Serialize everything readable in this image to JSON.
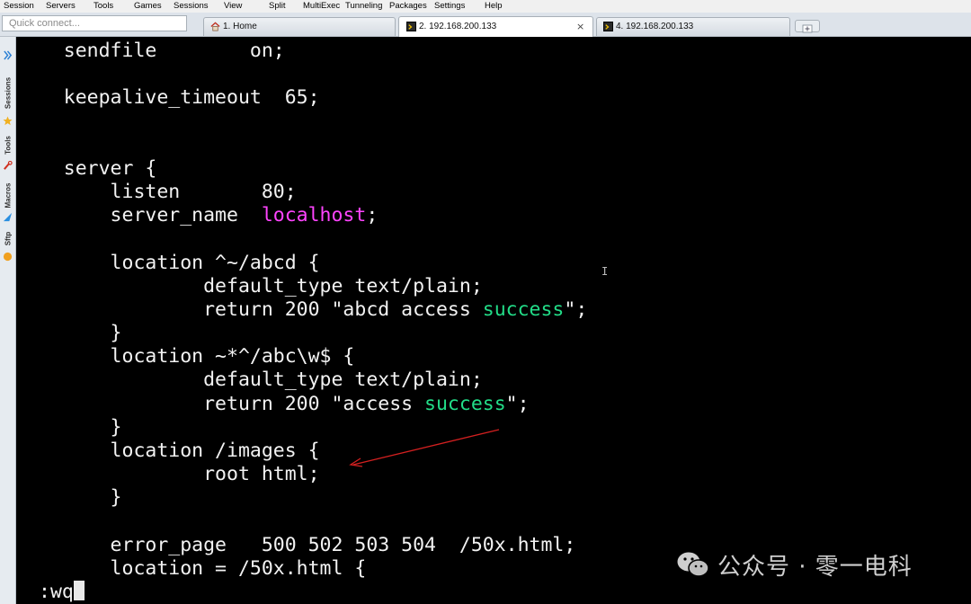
{
  "menu": [
    "Session",
    "Servers",
    "Tools",
    "Games",
    "Sessions",
    "View",
    "Split",
    "MultiExec",
    "Tunneling",
    "Packages",
    "Settings",
    "Help"
  ],
  "quick_connect": {
    "placeholder": "Quick connect..."
  },
  "tabs": [
    {
      "label": "1. Home",
      "icon": "home-icon"
    },
    {
      "label": "2. 192.168.200.133",
      "icon": "terminal-icon",
      "active": true,
      "close": "×"
    },
    {
      "label": "4. 192.168.200.133",
      "icon": "terminal-icon"
    }
  ],
  "sidebar": {
    "sessions": "Sessions",
    "tools": "Tools",
    "macros": "Macros",
    "sftp": "Sftp"
  },
  "terminal": {
    "lines": [
      [
        "    sendfile        on;"
      ],
      [
        ""
      ],
      [
        "    keepalive_timeout  65;"
      ],
      [
        ""
      ],
      [
        ""
      ],
      [
        "    server {"
      ],
      [
        "        listen       80;"
      ],
      [
        "        server_name  ",
        "localhost",
        ";"
      ],
      [
        ""
      ],
      [
        "        location ^~/abcd {"
      ],
      [
        "                default_type text/plain;"
      ],
      [
        "                return 200 \"abcd access ",
        "success",
        "\";"
      ],
      [
        "        }"
      ],
      [
        "        location ~*^/abc\\w$ {"
      ],
      [
        "                default_type text/plain;"
      ],
      [
        "                return 200 \"access ",
        "success",
        "\";"
      ],
      [
        "        }"
      ],
      [
        "        location /images {"
      ],
      [
        "                root html;"
      ],
      [
        "        }"
      ],
      [
        ""
      ],
      [
        "        error_page   500 502 503 504  /50x.html;"
      ],
      [
        "        location = /50x.html {"
      ]
    ],
    "command": ":wq"
  },
  "watermark": "公众号 · 零一电科",
  "colors": {
    "keyword_magenta": "#ff44ff",
    "string_green": "#22dd88",
    "annotation_arrow": "#d42020"
  }
}
